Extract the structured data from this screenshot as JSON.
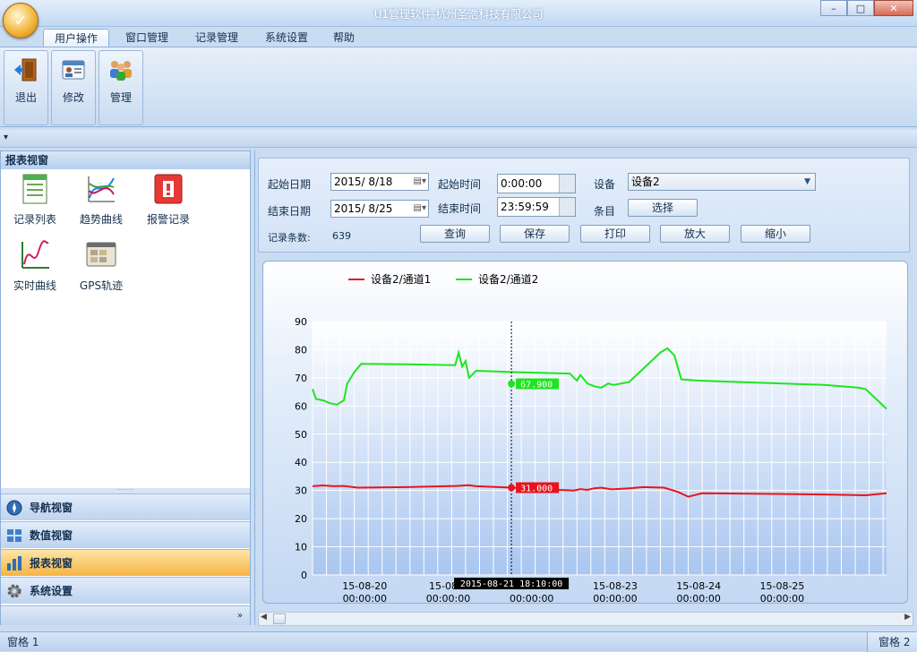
{
  "window": {
    "title": "U1管理软件-杭州圣浩科技有限公司",
    "app_icon": "app-orb-icon"
  },
  "tabs": [
    {
      "label": "用户操作",
      "active": true
    },
    {
      "label": "窗口管理",
      "active": false
    },
    {
      "label": "记录管理",
      "active": false
    },
    {
      "label": "系统设置",
      "active": false
    },
    {
      "label": "帮助",
      "active": false
    }
  ],
  "ribbon": {
    "buttons": [
      {
        "label": "退出",
        "icon": "exit-door-icon"
      },
      {
        "label": "修改",
        "icon": "id-card-icon"
      },
      {
        "label": "管理",
        "icon": "users-icon"
      }
    ]
  },
  "left_pane": {
    "header": "报表视窗",
    "items": [
      {
        "label": "记录列表",
        "icon": "record-list-icon"
      },
      {
        "label": "趋势曲线",
        "icon": "trend-curve-icon"
      },
      {
        "label": "报警记录",
        "icon": "alarm-record-icon"
      },
      {
        "label": "实时曲线",
        "icon": "realtime-curve-icon"
      },
      {
        "label": "GPS轨迹",
        "icon": "gps-track-icon"
      }
    ],
    "nav": [
      {
        "label": "导航视窗",
        "icon": "compass-icon",
        "active": false
      },
      {
        "label": "数值视窗",
        "icon": "grid-values-icon",
        "active": false
      },
      {
        "label": "报表视窗",
        "icon": "report-chart-icon",
        "active": true
      },
      {
        "label": "系统设置",
        "icon": "gear-icon",
        "active": false
      }
    ],
    "footer_glyph": "»"
  },
  "form": {
    "start_date_label": "起始日期",
    "start_date": "2015/ 8/18",
    "end_date_label": "结束日期",
    "end_date": "2015/ 8/25",
    "start_time_label": "起始时间",
    "start_time": "0:00:00",
    "end_time_label": "结束时间",
    "end_time": "23:59:59",
    "device_label": "设备",
    "device_value": "设备2",
    "items_label": "条目",
    "select_button": "选择",
    "record_count_label": "记录条数:",
    "record_count": "639",
    "buttons": {
      "query": "查询",
      "save": "保存",
      "print": "打印",
      "zoom_in": "放大",
      "zoom_out": "缩小"
    }
  },
  "status": {
    "left": "窗格 1",
    "right": "窗格 2"
  },
  "chart_data": {
    "type": "line",
    "title": "",
    "xlabel": "",
    "ylabel": "",
    "ylim": [
      0,
      90
    ],
    "yticks": [
      0,
      10,
      20,
      30,
      40,
      50,
      60,
      70,
      80,
      90
    ],
    "x_range": [
      "2015-08-19 09:00",
      "2015-08-26 06:00"
    ],
    "xticks": [
      {
        "date": "15-08-20",
        "time": "00:00:00"
      },
      {
        "date": "15-08-2",
        "time": "00:00:00"
      },
      {
        "date": "",
        "time": "00:00:00"
      },
      {
        "date": "15-08-23",
        "time": "00:00:00"
      },
      {
        "date": "15-08-24",
        "time": "00:00:00"
      },
      {
        "date": "15-08-25",
        "time": "00:00:00"
      }
    ],
    "grid": true,
    "legend": "top-left",
    "cursor": {
      "label": "2015-08-21  18:10:00",
      "values": [
        "31.000",
        "67.900"
      ]
    },
    "series": [
      {
        "name": "设备2/通道1",
        "color": "#e8141c",
        "points": [
          [
            "2015-08-19 09:00",
            31.5
          ],
          [
            "2015-08-19 12:00",
            31.8
          ],
          [
            "2015-08-19 15:00",
            31.5
          ],
          [
            "2015-08-19 18:00",
            31.6
          ],
          [
            "2015-08-19 22:00",
            31.0
          ],
          [
            "2015-08-20 12:00",
            31.2
          ],
          [
            "2015-08-21 02:00",
            31.6
          ],
          [
            "2015-08-21 06:00",
            31.9
          ],
          [
            "2015-08-21 08:00",
            31.5
          ],
          [
            "2015-08-21 20:00",
            30.9
          ],
          [
            "2015-08-22 12:00",
            30.0
          ],
          [
            "2015-08-22 14:00",
            30.5
          ],
          [
            "2015-08-22 16:00",
            30.2
          ],
          [
            "2015-08-22 18:00",
            30.8
          ],
          [
            "2015-08-22 20:00",
            31.0
          ],
          [
            "2015-08-22 23:00",
            30.4
          ],
          [
            "2015-08-23 04:00",
            30.8
          ],
          [
            "2015-08-23 08:00",
            31.2
          ],
          [
            "2015-08-23 14:00",
            31.0
          ],
          [
            "2015-08-23 18:00",
            29.5
          ],
          [
            "2015-08-23 21:00",
            27.8
          ],
          [
            "2015-08-23 23:00",
            28.4
          ],
          [
            "2015-08-24 01:00",
            29.0
          ],
          [
            "2015-08-24 12:00",
            28.9
          ],
          [
            "2015-08-25 12:00",
            28.6
          ],
          [
            "2015-08-26 00:00",
            28.3
          ],
          [
            "2015-08-26 06:00",
            29.0
          ]
        ]
      },
      {
        "name": "设备2/通道2",
        "color": "#1fe51f",
        "points": [
          [
            "2015-08-19 09:00",
            66.0
          ],
          [
            "2015-08-19 10:00",
            62.5
          ],
          [
            "2015-08-19 12:00",
            62.0
          ],
          [
            "2015-08-19 14:00",
            61.0
          ],
          [
            "2015-08-19 16:00",
            60.5
          ],
          [
            "2015-08-19 18:00",
            62.0
          ],
          [
            "2015-08-19 19:00",
            68.0
          ],
          [
            "2015-08-19 21:00",
            72.0
          ],
          [
            "2015-08-19 23:00",
            75.0
          ],
          [
            "2015-08-20 12:00",
            74.8
          ],
          [
            "2015-08-21 02:00",
            74.5
          ],
          [
            "2015-08-21 03:00",
            79.0
          ],
          [
            "2015-08-21 04:00",
            74.0
          ],
          [
            "2015-08-21 05:00",
            76.0
          ],
          [
            "2015-08-21 06:00",
            70.0
          ],
          [
            "2015-08-21 08:00",
            72.5
          ],
          [
            "2015-08-21 20:00",
            72.0
          ],
          [
            "2015-08-22 11:00",
            71.5
          ],
          [
            "2015-08-22 13:00",
            69.0
          ],
          [
            "2015-08-22 14:00",
            71.0
          ],
          [
            "2015-08-22 16:00",
            68.0
          ],
          [
            "2015-08-22 18:00",
            67.0
          ],
          [
            "2015-08-22 20:00",
            66.5
          ],
          [
            "2015-08-22 22:00",
            68.0
          ],
          [
            "2015-08-22 23:30",
            67.5
          ],
          [
            "2015-08-23 04:00",
            68.5
          ],
          [
            "2015-08-23 13:00",
            79.0
          ],
          [
            "2015-08-23 15:00",
            80.5
          ],
          [
            "2015-08-23 17:00",
            78.0
          ],
          [
            "2015-08-23 19:00",
            69.5
          ],
          [
            "2015-08-24 00:00",
            69.0
          ],
          [
            "2015-08-24 12:00",
            68.5
          ],
          [
            "2015-08-25 12:00",
            67.5
          ],
          [
            "2015-08-25 22:00",
            66.5
          ],
          [
            "2015-08-26 00:00",
            66.0
          ],
          [
            "2015-08-26 06:00",
            59.0
          ]
        ]
      }
    ]
  }
}
